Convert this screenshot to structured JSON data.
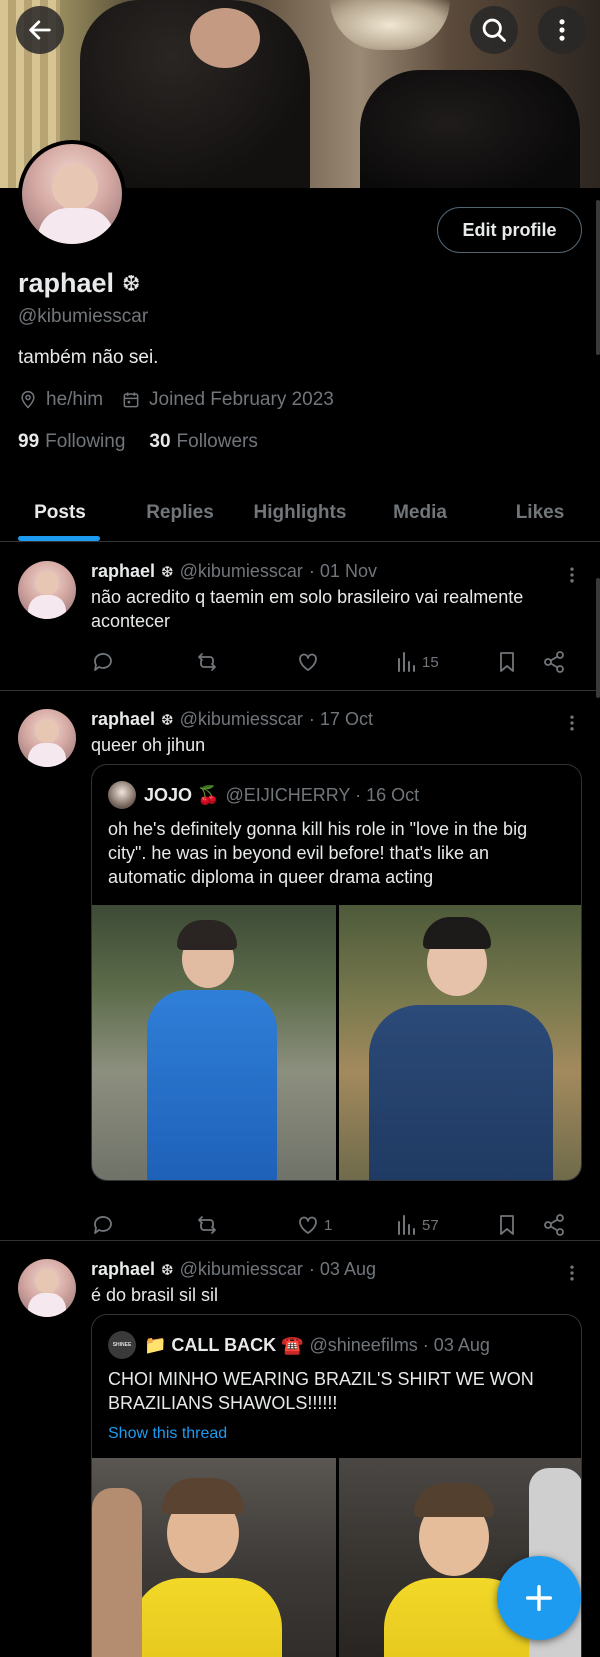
{
  "profile": {
    "name": "raphael",
    "verified_glyph": "❆",
    "handle": "@kibumiesscar",
    "bio": "também não sei.",
    "pronouns": "he/him",
    "joined": "Joined February 2023",
    "following_count": "99",
    "following_label": "Following",
    "followers_count": "30",
    "followers_label": "Followers",
    "edit_label": "Edit profile"
  },
  "tabs": [
    {
      "label": "Posts",
      "active": true
    },
    {
      "label": "Replies"
    },
    {
      "label": "Highlights"
    },
    {
      "label": "Media"
    },
    {
      "label": "Likes"
    }
  ],
  "posts": [
    {
      "name": "raphael",
      "handle": "@kibumiesscar",
      "date": "· 01 Nov",
      "text": "não acredito q taemin em solo brasileiro vai realmente acontecer",
      "likes": "",
      "views": "15"
    },
    {
      "name": "raphael",
      "handle": "@kibumiesscar",
      "date": "· 17 Oct",
      "text": "queer oh jihun",
      "likes": "1",
      "views": "57",
      "quote": {
        "name": "JOJO 🍒",
        "handle": "@EIJICHERRY · 16 Oct",
        "text": "oh he's definitely gonna kill his role in \"love in the big city\". he was in beyond evil before! that's like an automatic diploma in queer drama acting"
      }
    },
    {
      "name": "raphael",
      "handle": "@kibumiesscar",
      "date": "· 03 Aug",
      "text": "é do brasil sil sil",
      "quote": {
        "name": "📁 CALL BACK ☎️",
        "avatar_text": "SHINEE",
        "handle": "@shineefilms · 03 Aug",
        "text": "CHOI MINHO WEARING BRAZIL'S SHIRT WE WON BRAZILIANS SHAWOLS!!!!!!",
        "show_thread": "Show this thread"
      }
    }
  ],
  "icons": {
    "back": "arrow-left-icon",
    "search": "search-icon",
    "more": "more-vertical-icon",
    "compose": "plus-icon"
  },
  "colors": {
    "accent": "#1d9bf0",
    "muted": "#71767b",
    "text": "#e7e9ea",
    "border": "#2f3336",
    "background": "#000000"
  }
}
